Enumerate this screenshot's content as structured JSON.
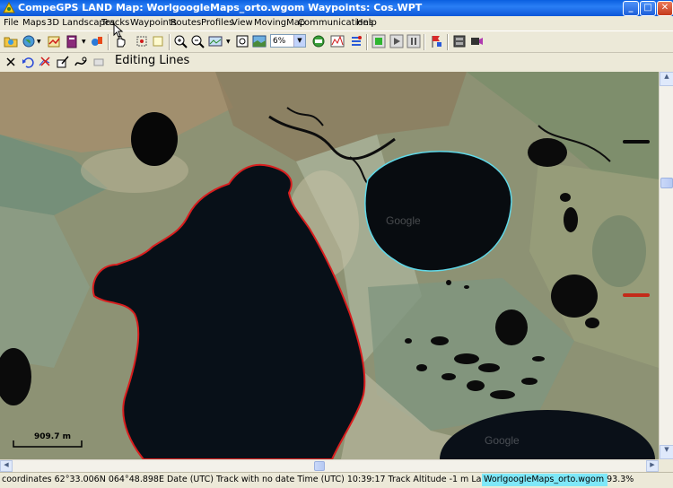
{
  "window": {
    "title": "CompeGPS LAND Map: WorlgoogleMaps_orto.wgom Waypoints:  Cos.WPT",
    "buttons": {
      "minimize": "_",
      "maximize": "□",
      "close": "✕"
    }
  },
  "menu": [
    "File",
    "Maps",
    "3D Landscapes",
    "Tracks",
    "Waypoints",
    "Routes",
    "Profiles",
    "View",
    "MovingMap",
    "Communications",
    "Help"
  ],
  "toolbar": {
    "zoom_combo": "6%",
    "icons": [
      "open-folder-icon",
      "globe-icon",
      "open-track-icon",
      "book-icon",
      "waypoint-icon",
      "hand-pan-icon",
      "select-icon",
      "zoom-in-icon",
      "zoom-out-icon",
      "map-view-icon",
      "zoom-box-icon",
      "satellite-icon",
      "layers-icon",
      "profile-chart-icon",
      "waypoint-list-icon",
      "gps-green-icon",
      "play-icon",
      "pause-icon",
      "flag-icon",
      "route-icon",
      "film-icon"
    ]
  },
  "edit_toolbar": {
    "label": "Editing Lines",
    "icons": [
      "close-icon",
      "undo-icon",
      "delete-point-icon",
      "edit-points-icon",
      "smooth-icon",
      "eraser-icon"
    ]
  },
  "map": {
    "scale_label": "909.7 m",
    "colors": {
      "track_red": "#d81e1e",
      "track_cyan": "#5fd8e8"
    }
  },
  "status": {
    "text": "coordinates 62°33.006N 064°48.898E Date (UTC) Track with no date Time (UTC) 10:39:17 Track Altitude -1 m Land Altitude ? Track",
    "progress_text": "WorlgoogleMaps_orto.wgom 93.3%"
  }
}
